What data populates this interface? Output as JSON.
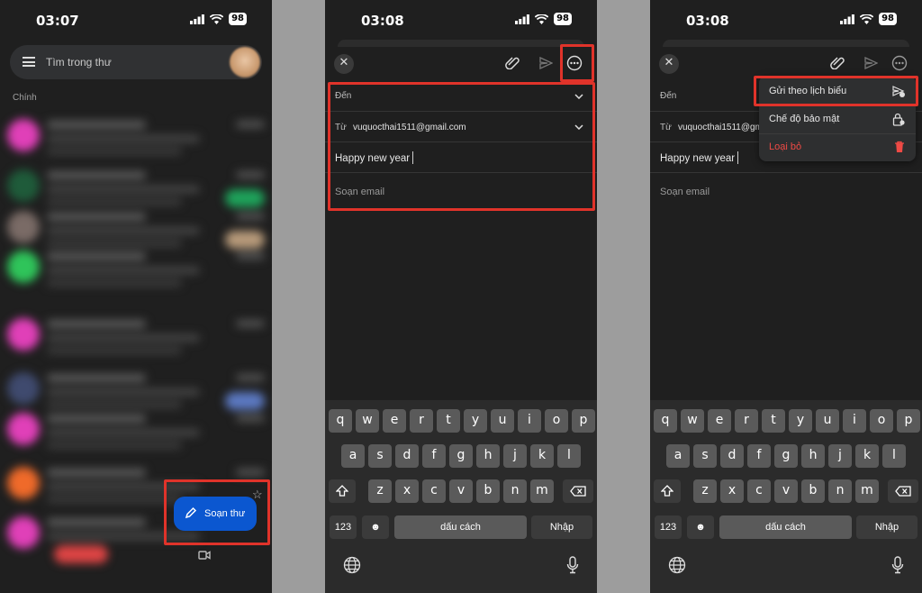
{
  "colors": {
    "highlight": "#e0332a",
    "fab": "#0b57d0",
    "danger": "#ef4a45",
    "background": "#1f1f1f"
  },
  "panel1": {
    "status": {
      "time": "03:07",
      "battery": "98"
    },
    "search": {
      "placeholder": "Tìm trong thư"
    },
    "section": "Chính",
    "compose_label": "Soạn thư"
  },
  "panel2": {
    "status": {
      "time": "03:08",
      "battery": "98"
    },
    "to_label": "Đến",
    "from_label": "Từ",
    "from_value": "vuquocthai1511@gmail.com",
    "subject": "Happy new year",
    "body_placeholder": "Soạn email"
  },
  "panel3": {
    "status": {
      "time": "03:08",
      "battery": "98"
    },
    "to_label": "Đến",
    "from_label": "Từ",
    "from_value": "vuquocthai1511@gmail.com",
    "subject": "Happy new year",
    "body_placeholder": "Soạn email",
    "menu": [
      {
        "label": "Gửi theo lịch biểu",
        "icon": "schedule-send-icon"
      },
      {
        "label": "Chế độ bảo mật",
        "icon": "confidential-lock-icon"
      },
      {
        "label": "Loại bỏ",
        "icon": "trash-icon"
      }
    ]
  },
  "keyboard": {
    "row1": [
      "q",
      "w",
      "e",
      "r",
      "t",
      "y",
      "u",
      "i",
      "o",
      "p"
    ],
    "row2": [
      "a",
      "s",
      "d",
      "f",
      "g",
      "h",
      "j",
      "k",
      "l"
    ],
    "row3": [
      "z",
      "x",
      "c",
      "v",
      "b",
      "n",
      "m"
    ],
    "numbers": "123",
    "space": "dấu cách",
    "return": "Nhập"
  }
}
